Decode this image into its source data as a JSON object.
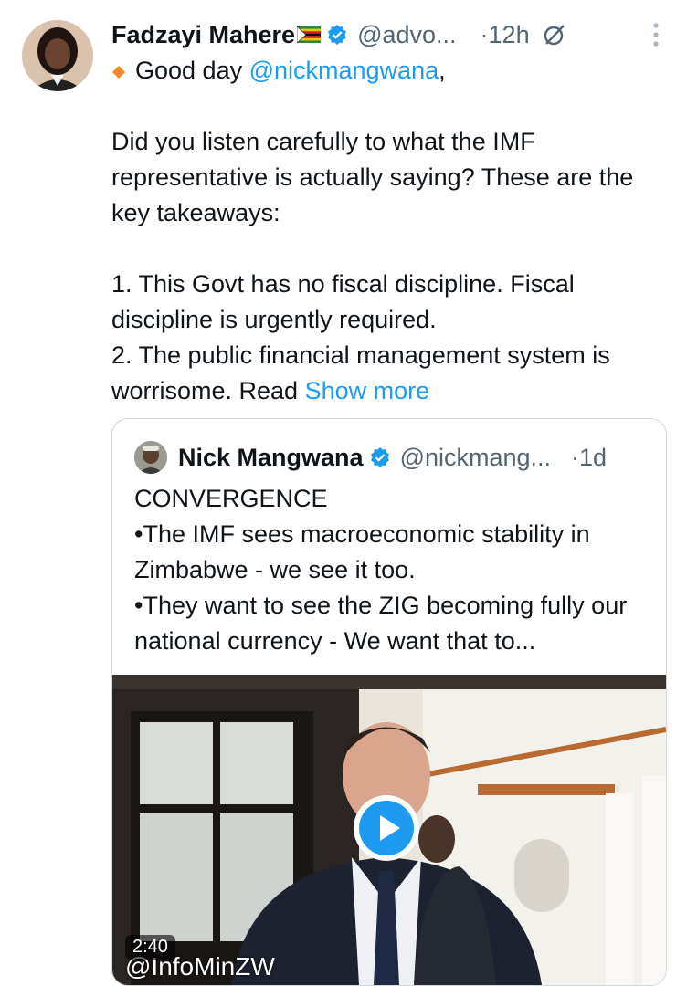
{
  "tweet": {
    "author_name": "Fadzayi Mahere",
    "handle": "@advo...",
    "time": "·12h",
    "greeting": "Good day ",
    "greeting_mention": "@nickmangwana",
    "greeting_comma": ",",
    "para1": "Did you listen carefully to what the IMF representative is actually saying? These are the key takeaways:",
    "line1": "1. This Govt has no fiscal discipline. Fiscal discipline is urgently required.",
    "line2_text": "2. The public financial management system is worrisome. Read ",
    "show_more": "Show more"
  },
  "quote": {
    "author_name": "Nick Mangwana",
    "handle": "@nickmang...",
    "time": "·1d",
    "line1": "CONVERGENCE",
    "line2": "•The IMF sees macroeconomic stability in Zimbabwe - we see it too.",
    "line3": "•They want to see the ZIG becoming fully our national currency - We want that to..."
  },
  "video": {
    "duration": "2:40",
    "watermark": "@InfoMinZW"
  },
  "colors": {
    "link": "#1d9bf0",
    "verified": "#1d9bf0",
    "secondary_text": "#536471",
    "border": "#cfd9de"
  },
  "icons": [
    "verified-badge-icon",
    "grok-icon",
    "more-options-icon",
    "play-icon",
    "zimbabwe-flag-icon",
    "orange-diamond-icon"
  ]
}
